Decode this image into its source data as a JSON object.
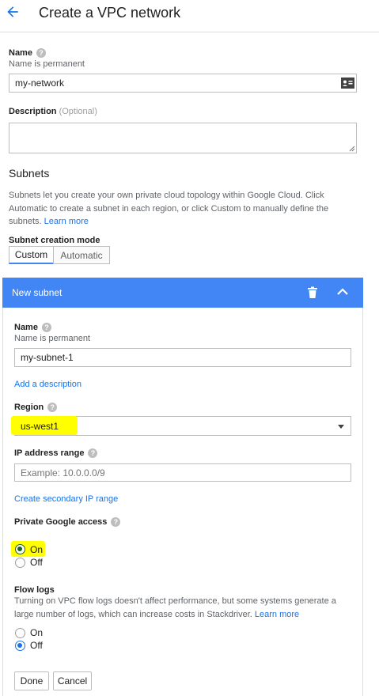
{
  "header": {
    "title": "Create a VPC network",
    "back_icon": "arrow-back-icon"
  },
  "name": {
    "label": "Name",
    "hint": "Name is permanent",
    "value": "my-network"
  },
  "description": {
    "label": "Description",
    "optional": "(Optional)",
    "value": ""
  },
  "subnets": {
    "heading": "Subnets",
    "text": "Subnets let you create your own private cloud topology within Google Cloud. Click Automatic to create a subnet in each region, or click Custom to manually define the subnets.",
    "learn_more": "Learn more",
    "mode_label": "Subnet creation mode",
    "modes": [
      "Custom",
      "Automatic"
    ],
    "selected_mode": "Custom"
  },
  "new_subnet": {
    "title": "New subnet",
    "name_label": "Name",
    "name_hint": "Name is permanent",
    "name_value": "my-subnet-1",
    "add_description": "Add a description",
    "region_label": "Region",
    "region_value": "us-west1",
    "ip_label": "IP address range",
    "ip_placeholder": "Example: 10.0.0.0/9",
    "secondary_range": "Create secondary IP range",
    "private_access_label": "Private Google access",
    "private_access_options": [
      "On",
      "Off"
    ],
    "private_access_selected": "On",
    "flow_logs_label": "Flow logs",
    "flow_logs_text": "Turning on VPC flow logs doesn't affect performance, but some systems generate a large number of logs, which can increase costs in Stackdriver.",
    "flow_logs_learn_more": "Learn more",
    "flow_logs_options": [
      "On",
      "Off"
    ],
    "flow_logs_selected": "Off"
  },
  "buttons": {
    "done": "Done",
    "cancel": "Cancel"
  },
  "colors": {
    "accent": "#4285f4",
    "link": "#1a73e8",
    "highlight": "#ffff00"
  }
}
